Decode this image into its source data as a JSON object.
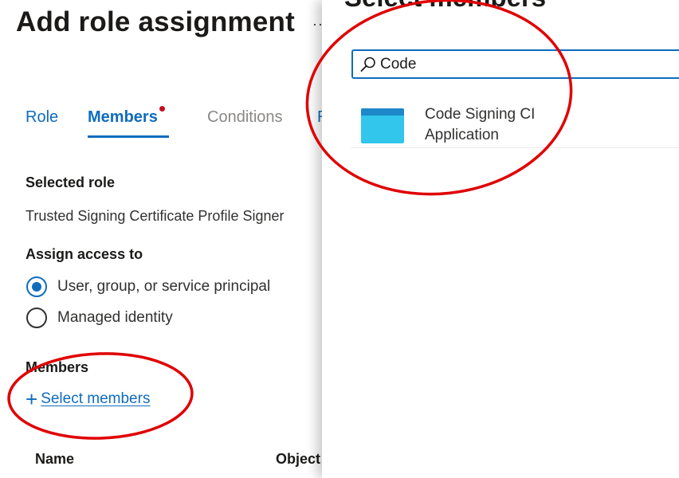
{
  "page": {
    "title": "Add role assignment",
    "more_glyph": "···"
  },
  "tabs": [
    {
      "label": "Role"
    },
    {
      "label": "Members",
      "active": true,
      "has_error_dot": true
    },
    {
      "label": "Conditions",
      "disabled": true
    },
    {
      "label": "R"
    }
  ],
  "selected_role": {
    "heading": "Selected role",
    "value": "Trusted Signing Certificate Profile Signer"
  },
  "assign_access": {
    "heading": "Assign access to",
    "options": [
      {
        "label": "User, group, or service principal",
        "checked": true
      },
      {
        "label": "Managed identity",
        "checked": false
      }
    ]
  },
  "members": {
    "heading": "Members",
    "select_link": "Select members",
    "plus_glyph": "+",
    "columns": [
      "Name",
      "Object"
    ]
  },
  "flyout": {
    "title": "Select members",
    "search": {
      "value": "Code",
      "placeholder": ""
    },
    "results": [
      {
        "line1": "Code Signing CI",
        "line2": "Application",
        "icon": "app-registration-icon"
      }
    ]
  },
  "colors": {
    "accent": "#0f6cbd",
    "error_dot": "#c50f1f",
    "annotation": "#e00000",
    "app_icon_top": "#1d87c9",
    "app_icon_body": "#32c6ec"
  }
}
